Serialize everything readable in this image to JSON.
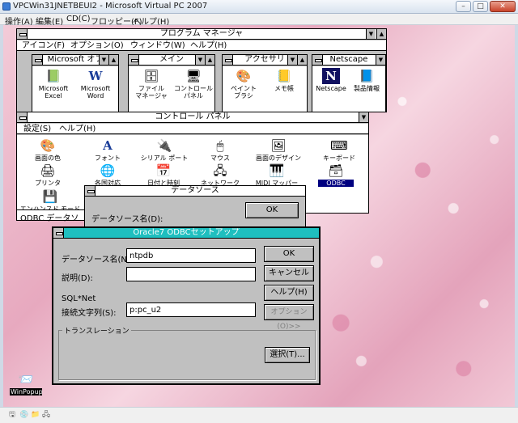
{
  "host": {
    "title": "VPCWin31JNETBEUI2 - Microsoft Virtual PC 2007",
    "controls": {
      "minimize": "–",
      "maximize": "□",
      "close": "✕"
    },
    "menu": [
      "操作(A)",
      "編集(E)",
      "CD(C)",
      "フロッピー(F)",
      "ヘルプ(H)"
    ],
    "status_icons": [
      "🖫",
      "💿",
      "📁",
      "🖧"
    ]
  },
  "program_manager": {
    "title": "プログラム マネージャ",
    "menu": [
      "アイコン(F)",
      "オプション(O)",
      "ウィンドウ(W)",
      "ヘルプ(H)"
    ],
    "groups": [
      {
        "title": "Microsoft オフ",
        "icons": [
          {
            "label": "Microsoft\nExcel",
            "glyph": "📗"
          },
          {
            "label": "Microsoft\nWord",
            "glyph": "W"
          }
        ]
      },
      {
        "title": "メイン",
        "icons": [
          {
            "label": "ファイル\nマネージャ",
            "glyph": "🗄"
          },
          {
            "label": "コントロール\nパネル",
            "glyph": "🖥"
          }
        ]
      },
      {
        "title": "アクセサリ",
        "icons": [
          {
            "label": "ペイント\nブラシ",
            "glyph": "🎨"
          },
          {
            "label": "メモ帳",
            "glyph": "📒"
          }
        ]
      },
      {
        "title": "Netscape",
        "icons": [
          {
            "label": "Netscape",
            "glyph": "N"
          },
          {
            "label": "製品情報",
            "glyph": "📘"
          }
        ]
      }
    ]
  },
  "control_panel": {
    "title": "コントロール パネル",
    "menu": [
      "設定(S)",
      "ヘルプ(H)"
    ],
    "icons": [
      {
        "label": "画面の色",
        "glyph": "🎨"
      },
      {
        "label": "フォント",
        "glyph": "A"
      },
      {
        "label": "シリアル ポート",
        "glyph": "🔌"
      },
      {
        "label": "マウス",
        "glyph": "🖱"
      },
      {
        "label": "画面のデザイン",
        "glyph": "🖼"
      },
      {
        "label": "キーボード",
        "glyph": "⌨"
      },
      {
        "label": "プリンタ",
        "glyph": "🖨"
      },
      {
        "label": "各国対応",
        "glyph": "🌐"
      },
      {
        "label": "日付と時刻",
        "glyph": "📅"
      },
      {
        "label": "ネットワーク",
        "glyph": "🖧"
      },
      {
        "label": "MIDI マッパー",
        "glyph": "🎹"
      },
      {
        "label": "ODBC",
        "glyph": "🗃"
      },
      {
        "label": "エンハンスド モード",
        "glyph": "💾"
      }
    ]
  },
  "odbc_minimized_label": "ODBC データソ",
  "datasource_dialog": {
    "title": "データソース",
    "label": "データソース名(D):",
    "ok": "OK"
  },
  "oracle_dialog": {
    "title": "Oracle7 ODBCセットアップ",
    "dsn_label": "データソース名(N):",
    "dsn_value": "ntpdb",
    "desc_label": "説明(D):",
    "desc_value": "",
    "sqlnet_label": "SQL*Net",
    "conn_label": "接続文字列(S):",
    "conn_value": "p:pc_u2",
    "translation_label": "トランスレーション",
    "ok": "OK",
    "cancel": "キャンセル",
    "help": "ヘルプ(H)",
    "options": "オプション(O)>>",
    "select": "選択(T)..."
  },
  "desktop_icon": {
    "label": "WinPopup",
    "glyph": "📨"
  }
}
